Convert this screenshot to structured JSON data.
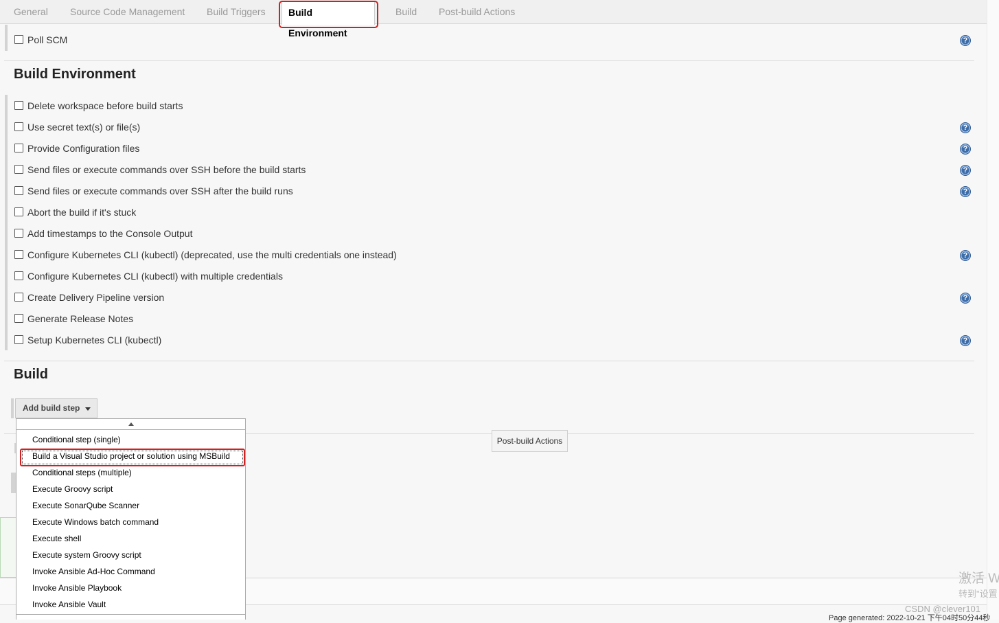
{
  "tabs": [
    {
      "label": "General"
    },
    {
      "label": "Source Code Management"
    },
    {
      "label": "Build Triggers"
    },
    {
      "label": "Build Environment"
    },
    {
      "label": "Build"
    },
    {
      "label": "Post-build Actions"
    }
  ],
  "triggers": {
    "poll_scm": "Poll SCM"
  },
  "build_env": {
    "title": "Build Environment",
    "options": [
      {
        "label": "Delete workspace before build starts",
        "checked": false
      },
      {
        "label": "Use secret text(s) or file(s)",
        "checked": false
      },
      {
        "label": "Provide Configuration files",
        "checked": false
      },
      {
        "label": "Send files or execute commands over SSH before the build starts",
        "checked": false
      },
      {
        "label": "Send files or execute commands over SSH after the build runs",
        "checked": false
      },
      {
        "label": "Abort the build if it's stuck",
        "checked": false
      },
      {
        "label": "Add timestamps to the Console Output",
        "checked": false
      },
      {
        "label": "Configure Kubernetes CLI (kubectl) (deprecated, use the multi credentials one instead)",
        "checked": false
      },
      {
        "label": "Configure Kubernetes CLI (kubectl) with multiple credentials",
        "checked": false
      },
      {
        "label": "Create Delivery Pipeline version",
        "checked": false
      },
      {
        "label": "Generate Release Notes",
        "checked": false
      },
      {
        "label": "Setup Kubernetes CLI (kubectl)",
        "checked": false
      }
    ]
  },
  "build": {
    "title": "Build",
    "add_step_label": "Add build step",
    "menu": [
      "Conditional step (single)",
      "Build a Visual Studio project or solution using MSBuild",
      "Conditional steps (multiple)",
      "Execute Groovy script",
      "Execute SonarQube Scanner",
      "Execute Windows batch command",
      "Execute shell",
      "Execute system Groovy script",
      "Invoke Ansible Ad-Hoc Command",
      "Invoke Ansible Playbook",
      "Invoke Ansible Vault"
    ]
  },
  "post_build": {
    "button_label": "Post-build Actions"
  },
  "footer": {
    "page_generated": "Page generated: 2022-10-21 下午04时50分44秒"
  },
  "watermarks": {
    "activate_line1": "激活 W",
    "activate_line2": "转到\"设置",
    "csdn": "CSDN @clever101"
  },
  "colors": {
    "accent_red": "#d21f1f",
    "help_blue": "#3d6da8"
  }
}
